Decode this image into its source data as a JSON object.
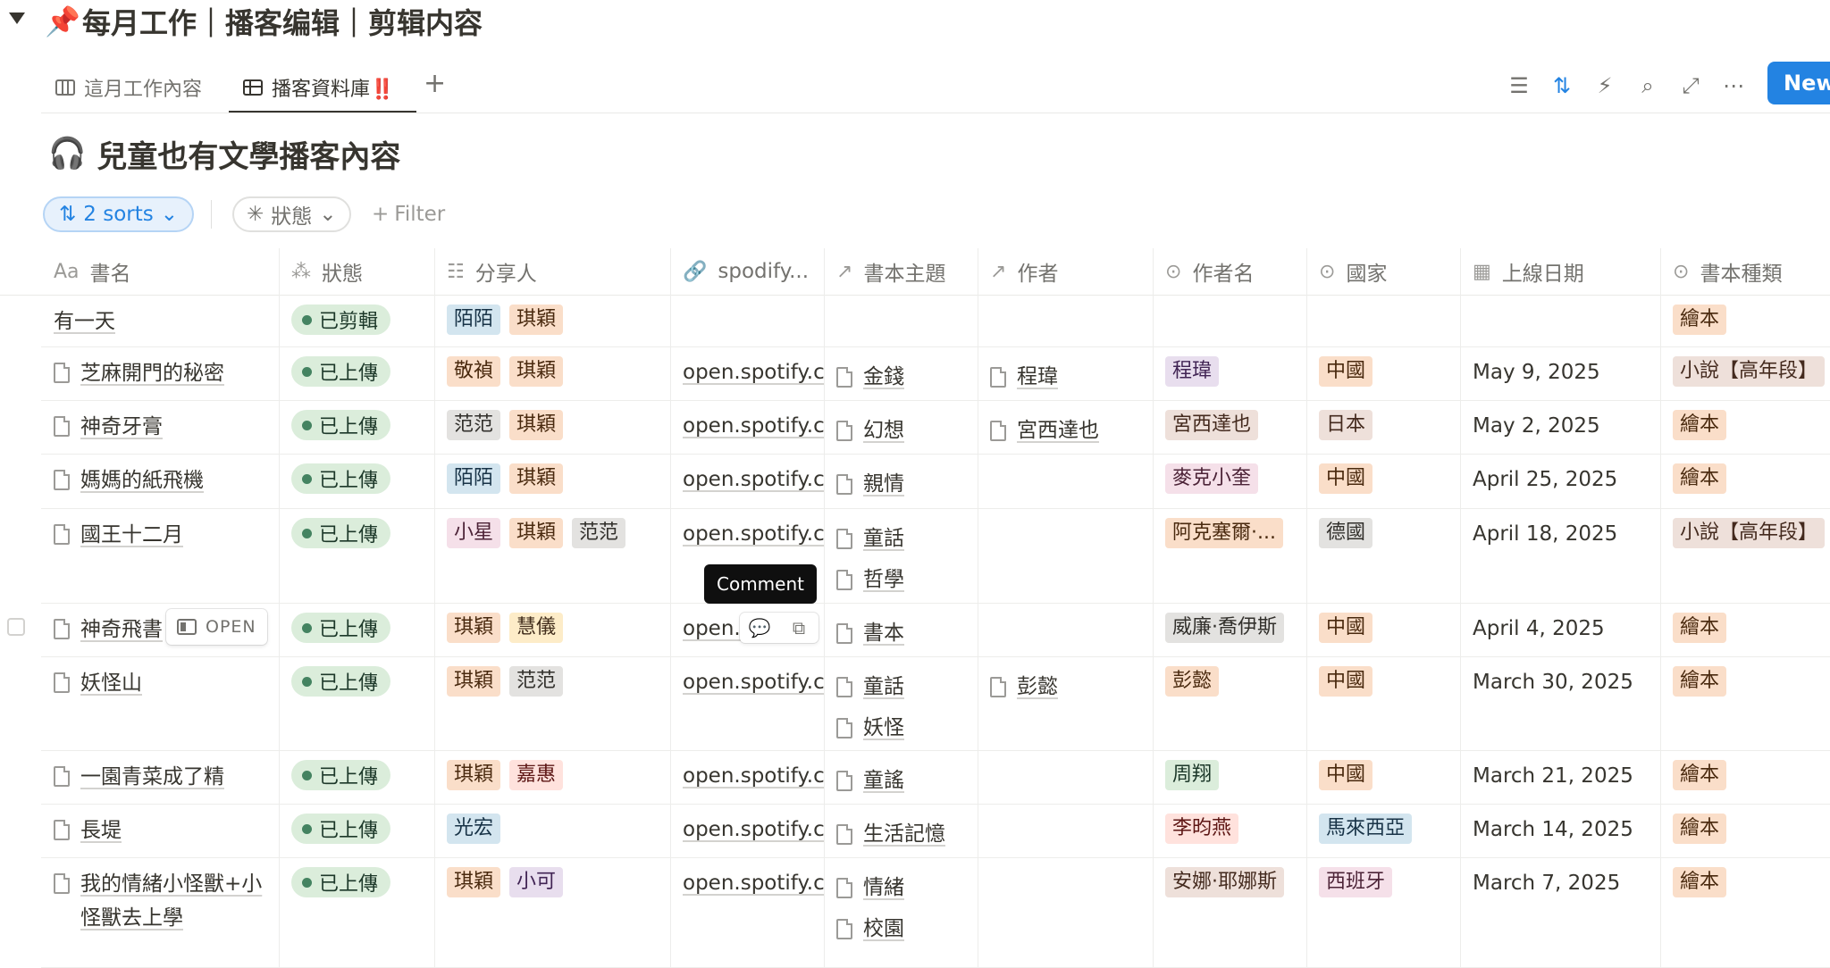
{
  "page": {
    "title": "每月工作｜播客编辑｜剪辑内容",
    "pin_icon": "pushpin-icon"
  },
  "tabs": [
    {
      "label": "這月工作內容",
      "icon": "board-icon",
      "active": false
    },
    {
      "label": "播客資料庫‼️",
      "icon": "table-icon",
      "active": true
    }
  ],
  "toolbar": {
    "new_label": "New"
  },
  "database": {
    "title": "兒童也有文學播客內容",
    "icon": "headphones-icon"
  },
  "filters": {
    "sorts_label": "2 sorts",
    "status_label": "狀態",
    "add_filter_label": "Filter"
  },
  "columns": [
    {
      "label": "書名",
      "icon": "Aa"
    },
    {
      "label": "狀態",
      "icon": "status-icon"
    },
    {
      "label": "分享人",
      "icon": "list-icon"
    },
    {
      "label": "spodify...",
      "icon": "link-icon"
    },
    {
      "label": "書本主題",
      "icon": "relation-arrow-icon"
    },
    {
      "label": "作者",
      "icon": "relation-arrow-icon"
    },
    {
      "label": "作者名",
      "icon": "select-icon"
    },
    {
      "label": "國家",
      "icon": "select-icon"
    },
    {
      "label": "上線日期",
      "icon": "calendar-icon"
    },
    {
      "label": "書本種類",
      "icon": "select-icon"
    }
  ],
  "rows": [
    {
      "title": "有一天",
      "has_doc": false,
      "status": "已剪輯",
      "sharers": [
        [
          "陌陌",
          "blue"
        ],
        [
          "琪穎",
          "orange"
        ]
      ],
      "link": "",
      "topics": [],
      "authors": [],
      "author_name": [],
      "country": [],
      "date": "",
      "type": [
        [
          "繪本",
          "orange"
        ]
      ]
    },
    {
      "title": "芝麻開門的秘密",
      "has_doc": true,
      "status": "已上傳",
      "sharers": [
        [
          "敬禎",
          "orange"
        ],
        [
          "琪穎",
          "orange"
        ]
      ],
      "link": "open.spotify.com",
      "topics": [
        "金錢"
      ],
      "authors": [
        "程瑋"
      ],
      "author_name": [
        [
          "程瑋",
          "purple"
        ]
      ],
      "country": [
        [
          "中國",
          "orange"
        ]
      ],
      "date": "May 9, 2025",
      "type": [
        [
          "小說【高年段】",
          "brown"
        ]
      ]
    },
    {
      "title": "神奇牙膏",
      "has_doc": true,
      "status": "已上傳",
      "sharers": [
        [
          "范范",
          "gray"
        ],
        [
          "琪穎",
          "orange"
        ]
      ],
      "link": "open.spotify.com",
      "topics": [
        "幻想"
      ],
      "authors": [
        "宮西達也"
      ],
      "author_name": [
        [
          "宮西達也",
          "brown"
        ]
      ],
      "country": [
        [
          "日本",
          "brown"
        ]
      ],
      "date": "May 2, 2025",
      "type": [
        [
          "繪本",
          "orange"
        ]
      ]
    },
    {
      "title": "媽媽的紙飛機",
      "has_doc": true,
      "status": "已上傳",
      "sharers": [
        [
          "陌陌",
          "blue"
        ],
        [
          "琪穎",
          "orange"
        ]
      ],
      "link": "open.spotify.com",
      "topics": [
        "親情"
      ],
      "authors": [],
      "author_name": [
        [
          "麥克小奎",
          "pink"
        ]
      ],
      "country": [
        [
          "中國",
          "orange"
        ]
      ],
      "date": "April 25, 2025",
      "type": [
        [
          "繪本",
          "orange"
        ]
      ]
    },
    {
      "title": "國王十二月",
      "has_doc": true,
      "status": "已上傳",
      "sharers": [
        [
          "小星",
          "pink"
        ],
        [
          "琪穎",
          "orange"
        ],
        [
          "范范",
          "gray"
        ]
      ],
      "link": "open.spotify.com",
      "topics": [
        "童話",
        "哲學"
      ],
      "authors": [],
      "author_name": [
        [
          "阿克塞爾·...",
          "orange"
        ]
      ],
      "country": [
        [
          "德國",
          "gray"
        ]
      ],
      "date": "April 18, 2025",
      "type": [
        [
          "小說【高年段】",
          "brown"
        ]
      ]
    },
    {
      "title": "神奇飛書",
      "has_doc": true,
      "status": "已上傳",
      "sharers": [
        [
          "琪穎",
          "orange"
        ],
        [
          "慧儀",
          "yellow"
        ]
      ],
      "link": "open.",
      "topics": [
        "書本"
      ],
      "authors": [],
      "author_name": [
        [
          "威廉·喬伊斯",
          "gray"
        ]
      ],
      "country": [
        [
          "中國",
          "orange"
        ]
      ],
      "date": "April 4, 2025",
      "type": [
        [
          "繪本",
          "orange"
        ]
      ]
    },
    {
      "title": "妖怪山",
      "has_doc": true,
      "status": "已上傳",
      "sharers": [
        [
          "琪穎",
          "orange"
        ],
        [
          "范范",
          "gray"
        ]
      ],
      "link": "open.spotify.com",
      "topics": [
        "童話",
        "妖怪"
      ],
      "authors": [
        "彭懿"
      ],
      "author_name": [
        [
          "彭懿",
          "orange"
        ]
      ],
      "country": [
        [
          "中國",
          "orange"
        ]
      ],
      "date": "March 30, 2025",
      "type": [
        [
          "繪本",
          "orange"
        ]
      ]
    },
    {
      "title": "一園青菜成了精",
      "has_doc": true,
      "status": "已上傳",
      "sharers": [
        [
          "琪穎",
          "orange"
        ],
        [
          "嘉惠",
          "red"
        ]
      ],
      "link": "open.spotify.com",
      "topics": [
        "童謠"
      ],
      "authors": [],
      "author_name": [
        [
          "周翔",
          "green"
        ]
      ],
      "country": [
        [
          "中國",
          "orange"
        ]
      ],
      "date": "March 21, 2025",
      "type": [
        [
          "繪本",
          "orange"
        ]
      ]
    },
    {
      "title": "長堤",
      "has_doc": true,
      "status": "已上傳",
      "sharers": [
        [
          "光宏",
          "blue"
        ]
      ],
      "link": "open.spotify.com",
      "topics": [
        "生活記憶"
      ],
      "authors": [],
      "author_name": [
        [
          "李昀燕",
          "red"
        ]
      ],
      "country": [
        [
          "馬來西亞",
          "blue"
        ]
      ],
      "date": "March 14, 2025",
      "type": [
        [
          "繪本",
          "orange"
        ]
      ]
    },
    {
      "title": "我的情緒小怪獸+小怪獸去上學",
      "has_doc": true,
      "status": "已上傳",
      "sharers": [
        [
          "琪穎",
          "orange"
        ],
        [
          "小可",
          "purple"
        ]
      ],
      "link": "open.spotify.com",
      "topics": [
        "情緒",
        "校園"
      ],
      "authors": [],
      "author_name": [
        [
          "安娜·耶娜斯",
          "brown"
        ]
      ],
      "country": [
        [
          "西班牙",
          "pink"
        ]
      ],
      "date": "March 7, 2025",
      "type": [
        [
          "繪本",
          "orange"
        ]
      ]
    }
  ],
  "overlay": {
    "open_label": "OPEN",
    "tooltip_label": "Comment"
  }
}
